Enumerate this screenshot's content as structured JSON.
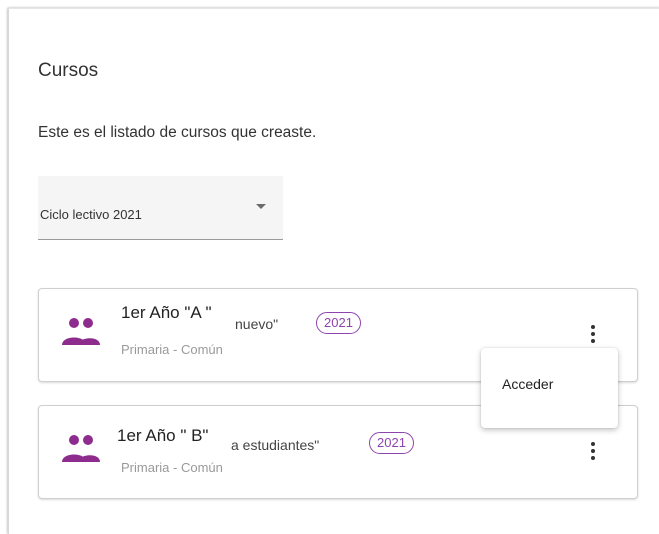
{
  "page": {
    "title": "Cursos",
    "subtitle": "Este es el listado de cursos que creaste."
  },
  "filter": {
    "selected": "Ciclo lectivo 2021"
  },
  "courses": [
    {
      "name": "1er Año \"A \"",
      "overlay_text": "nuevo\"",
      "year": "2021",
      "level": "Primaria - Común"
    },
    {
      "name": "1er Año \" B\"",
      "overlay_text": "a estudiantes\"",
      "year": "2021",
      "level": "Primaria - Común"
    }
  ],
  "menu": {
    "items": [
      "Acceder"
    ]
  },
  "colors": {
    "accent": "#8e44ad",
    "icon": "#8e2c8e"
  },
  "icons": {
    "course": "people-icon",
    "more": "more-vert-icon",
    "dropdown": "arrow-drop-down-icon"
  }
}
